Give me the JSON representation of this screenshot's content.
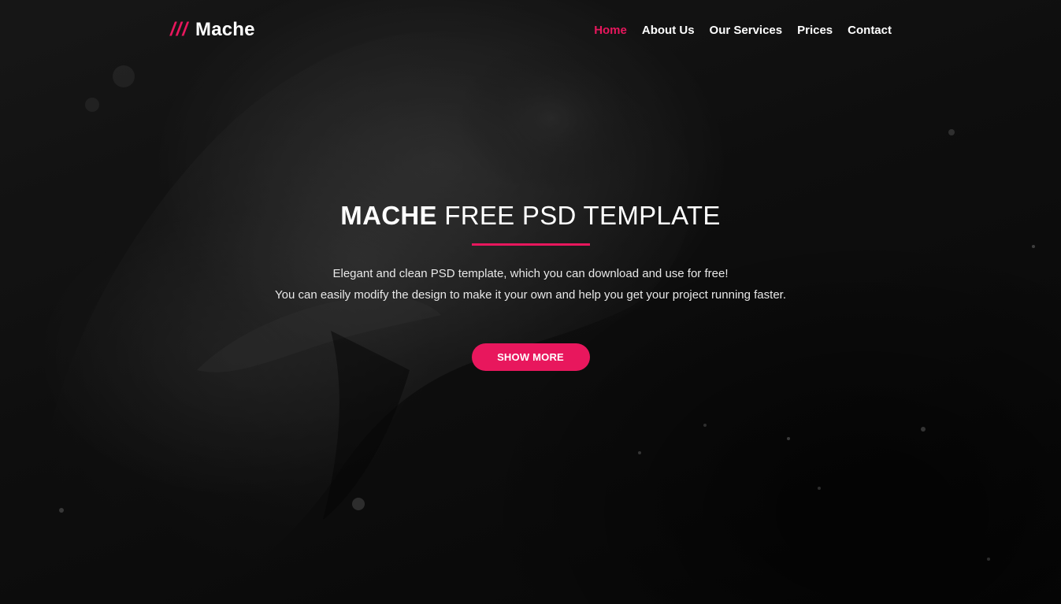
{
  "header": {
    "logo_mark": "///",
    "logo_text": "Mache",
    "nav": [
      {
        "label": "Home",
        "active": true
      },
      {
        "label": "About Us",
        "active": false
      },
      {
        "label": "Our Services",
        "active": false
      },
      {
        "label": "Prices",
        "active": false
      },
      {
        "label": "Contact",
        "active": false
      }
    ]
  },
  "hero": {
    "title_strong": "MACHE",
    "title_light": "FREE PSD TEMPLATE",
    "text_line1": "Elegant and clean PSD template, which you can download and use for free!",
    "text_line2": "You can easily modify the design to make it your own and help you get your project running faster.",
    "button_label": "SHOW MORE",
    "background_image": "underwater-figure-photo"
  },
  "colors": {
    "accent": "#e8175d",
    "text": "#ffffff",
    "background": "#0a0a0a"
  }
}
